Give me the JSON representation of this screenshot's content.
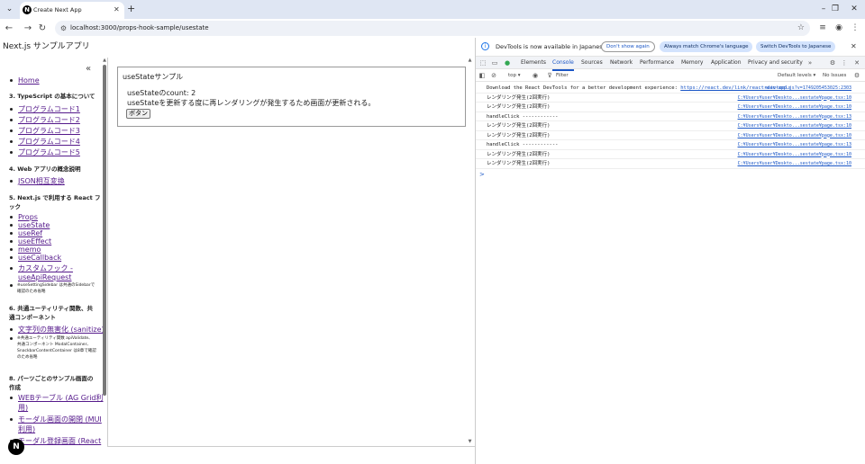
{
  "browser": {
    "tab_title": "Create Next App",
    "url": "localhost:3000/props-hook-sample/usestate"
  },
  "page": {
    "header": "Next.js サンプルアプリ",
    "sidebar": {
      "home": "Home",
      "section3": "3. TypeScript の基本について",
      "section3_items": [
        "プログラムコード1",
        "プログラムコード2",
        "プログラムコード3",
        "プログラムコード4",
        "プログラムコード5"
      ],
      "section4": "4. Web アプリの概念説明",
      "section4_items": [
        "JSON相互変換"
      ],
      "section5_line1": "5. Next.js で利用する React フ",
      "section5_line2": "ック",
      "section5_items": [
        "Props",
        "useState",
        "useRef",
        "useEffect",
        "memo",
        "useCallback"
      ],
      "section5_custom_line1": "カスタムフック -",
      "section5_custom_line2": "useApiRequest",
      "section5_note_line1": "※useSettingSidebar は共通のSidebarで",
      "section5_note_line2": "確認のため省略",
      "section6_line1": "6. 共通ユーティリティ関数、共",
      "section6_line2": "通コンポーネント",
      "section6_item": "文字列の無害化 (sanitize)",
      "section6_note_line1": "※共通ユーティリティ関数 apiValidate、",
      "section6_note_line2": "共通コンポーネント ModalContainer、",
      "section6_note_line3": "SnackbarContentContainer は8章で確認",
      "section6_note_line4": "のため省略",
      "section8_line1": "8. パーツごとのサンプル画面の",
      "section8_line2": "作成",
      "section8_item1_line1": "WEBテーブル (AG Grid利",
      "section8_item1_line2": "用)",
      "section8_item2_line1": "モーダル画面の開閉 (MUI",
      "section8_item2_line2": "利用)",
      "section8_item3_line1": "モーダル登録画面 (React"
    },
    "card": {
      "title": "useStateサンプル",
      "count_label": "useStateのcount: 2",
      "description": "useStateを更新する度に再レンダリングが発生するため画面が更新される。",
      "button_label": "ボタン"
    },
    "next_badge": "N"
  },
  "devtools": {
    "infobar": {
      "message": "DevTools is now available in Japanese",
      "dont_show": "Don't show again",
      "match_language": "Always match Chrome's language",
      "switch_language": "Switch DevTools to Japanese"
    },
    "tabs": [
      "Elements",
      "Console",
      "Sources",
      "Network",
      "Performance",
      "Memory",
      "Application",
      "Privacy and security"
    ],
    "active_tab": "Console",
    "toolbar": {
      "context": "top ▾",
      "filter_placeholder": "Filter",
      "levels": "Default levels ▾",
      "issues": "No Issues"
    },
    "console_rows": [
      {
        "text": "Download the React DevTools for a better development experience: ",
        "inline_link": "https://react.dev/link/react-devtools",
        "source": "main-app.js?v=1749205453025:2303"
      },
      {
        "text": "レンダリング発生(2回実行)",
        "source": "C:¥Users¥user¥Deskto...sestate¥page.tsx:10"
      },
      {
        "text": "レンダリング発生(2回実行)",
        "source": "C:¥Users¥user¥Deskto...sestate¥page.tsx:10"
      },
      {
        "text": "handleClick ------------",
        "source": "C:¥Users¥user¥Deskto...sestate¥page.tsx:13"
      },
      {
        "text": "レンダリング発生(2回実行)",
        "source": "C:¥Users¥user¥Deskto...sestate¥page.tsx:10"
      },
      {
        "text": "レンダリング発生(2回実行)",
        "source": "C:¥Users¥user¥Deskto...sestate¥page.tsx:10"
      },
      {
        "text": "handleClick ------------",
        "source": "C:¥Users¥user¥Deskto...sestate¥page.tsx:13"
      },
      {
        "text": "レンダリング発生(2回実行)",
        "source": "C:¥Users¥user¥Deskto...sestate¥page.tsx:10"
      },
      {
        "text": "レンダリング発生(2回実行)",
        "source": "C:¥Users¥user¥Deskto...sestate¥page.tsx:10"
      }
    ],
    "prompt": ">"
  },
  "icons": {
    "tab_list": "chevron-down-icon",
    "new_tab": "plus-icon",
    "back": "arrow-left-icon",
    "forward": "arrow-right-icon",
    "reload": "reload-icon",
    "site_info": "tune-icon",
    "bookmark": "star-icon",
    "profile": "profile-icon",
    "menu": "kebab-icon"
  }
}
